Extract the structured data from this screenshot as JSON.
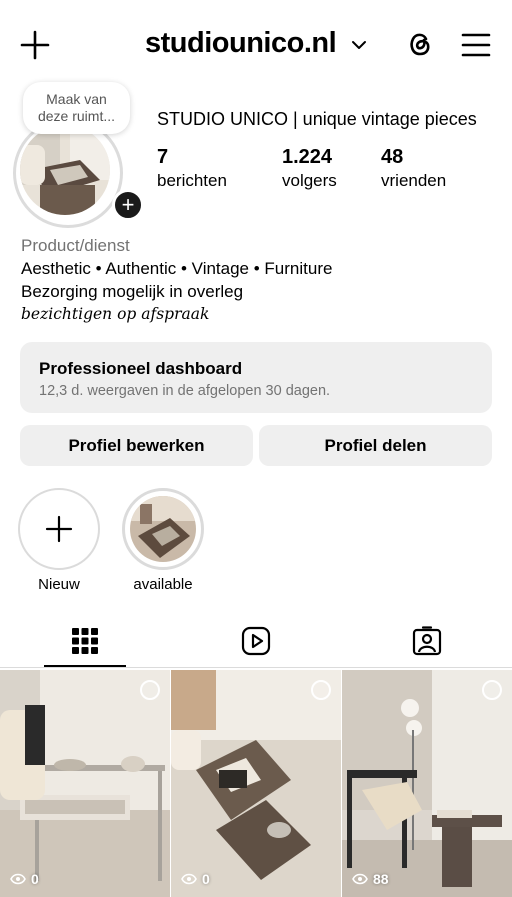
{
  "header": {
    "username": "studiounico.nl"
  },
  "profile": {
    "note": [
      "Maak van",
      "deze ruimt..."
    ],
    "display_name": "STUDIO UNICO | unique vintage pieces",
    "stats": [
      {
        "value": "7",
        "label": "berichten"
      },
      {
        "value": "1.224",
        "label": "volgers"
      },
      {
        "value": "48",
        "label": "vrienden"
      }
    ],
    "category": "Product/dienst",
    "bio": [
      "Aesthetic • Authentic • Vintage • Furniture",
      "Bezorging mogelijk in overleg",
      "bezichtigen op afspraak"
    ]
  },
  "dashboard": {
    "title": "Professioneel dashboard",
    "subtitle": "12,3 d. weergaven in de afgelopen 30 dagen."
  },
  "buttons": {
    "edit": "Profiel bewerken",
    "share": "Profiel delen"
  },
  "highlights": [
    {
      "label": "Nieuw"
    },
    {
      "label": "available"
    }
  ],
  "posts": [
    {
      "views": "0"
    },
    {
      "views": "0"
    },
    {
      "views": "88"
    }
  ],
  "icons": {
    "top_left": "plus-icon",
    "dropdown": "chevron-down-icon",
    "threads": "threads-icon",
    "menu": "hamburger-menu-icon",
    "tabs": [
      "grid-icon",
      "reels-icon",
      "tagged-icon"
    ],
    "views": "eye-icon"
  }
}
